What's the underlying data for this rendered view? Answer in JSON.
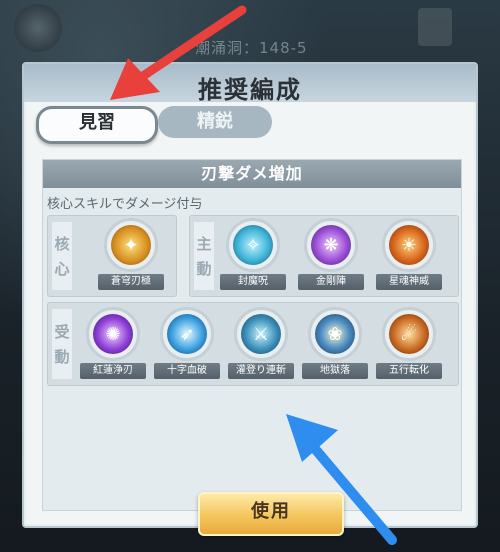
{
  "background": {
    "stage_text": "潮涌洞：148-5"
  },
  "panel": {
    "title": "推奨編成"
  },
  "tabs": [
    {
      "label": "見習",
      "active": true
    },
    {
      "label": "精鋭",
      "active": false
    }
  ],
  "section": {
    "title": "刃撃ダメ増加",
    "description": "核心スキルでダメージ付与"
  },
  "groups": {
    "core": {
      "label_chars": [
        "核",
        "心"
      ],
      "skills": [
        {
          "name": "蒼穹刃極",
          "icon": "golden-blade-icon"
        }
      ]
    },
    "main": {
      "label_chars": [
        "主",
        "動"
      ],
      "skills": [
        {
          "name": "封魔呪",
          "icon": "seal-spirit-icon"
        },
        {
          "name": "金剛陣",
          "icon": "purple-feather-icon"
        },
        {
          "name": "星魂神威",
          "icon": "fire-spirit-icon"
        }
      ]
    },
    "passive": {
      "label_chars": [
        "受",
        "動"
      ],
      "skills": [
        {
          "name": "紅蓮浄刃",
          "icon": "purple-burst-icon"
        },
        {
          "name": "十字血破",
          "icon": "blue-strike-icon"
        },
        {
          "name": "灌登り連斬",
          "icon": "swords-flurry-icon"
        },
        {
          "name": "地獄落",
          "icon": "lotus-flame-icon"
        },
        {
          "name": "五行転化",
          "icon": "golden-slash-icon"
        }
      ]
    }
  },
  "use_button": {
    "label": "使用"
  },
  "colors": {
    "accent_gold": "#f4c65c",
    "arrow_red": "#e8403a",
    "arrow_blue": "#2f8df0"
  }
}
